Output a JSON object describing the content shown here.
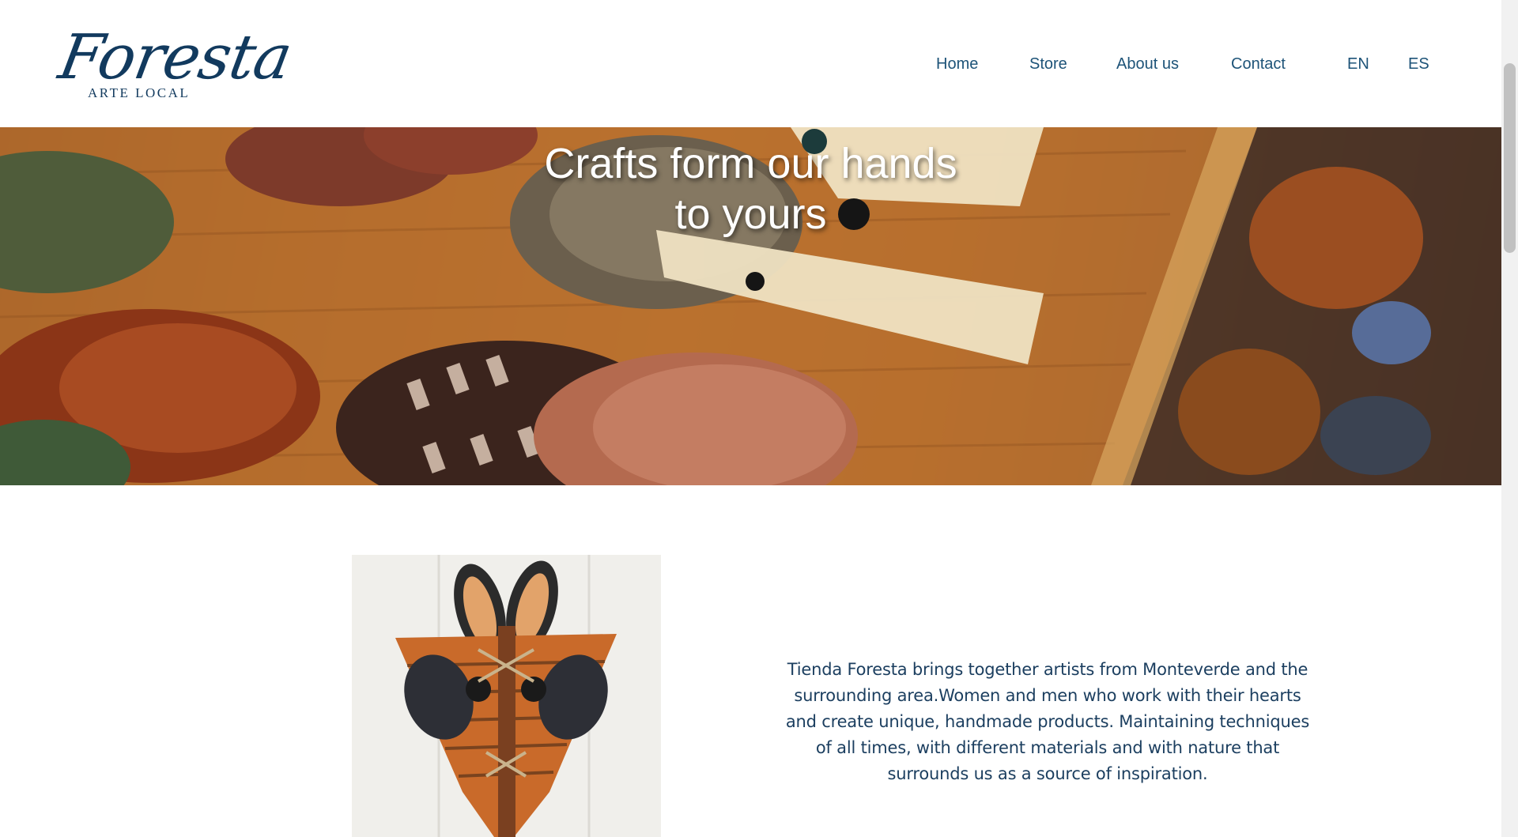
{
  "header": {
    "logo": {
      "title": "Foresta",
      "subtitle": "ARTE LOCAL"
    },
    "nav": [
      {
        "label": "Home"
      },
      {
        "label": "Store"
      },
      {
        "label": "About us"
      },
      {
        "label": "Contact"
      }
    ],
    "languages": [
      {
        "label": "EN"
      },
      {
        "label": "ES"
      }
    ]
  },
  "hero": {
    "title_line1": "Crafts form our hands",
    "title_line2": "to yours"
  },
  "intro": {
    "text": "Tienda Foresta brings together artists from Monteverde and the surrounding area.Women and men who work with their hearts and create unique, handmade products. Maintaining techniques of all times, with different materials and with nature that surrounds us as a source of inspiration."
  },
  "colors": {
    "brand": "#123a5e",
    "nav_text": "#1d5378",
    "body_text": "#1b3e5f"
  }
}
